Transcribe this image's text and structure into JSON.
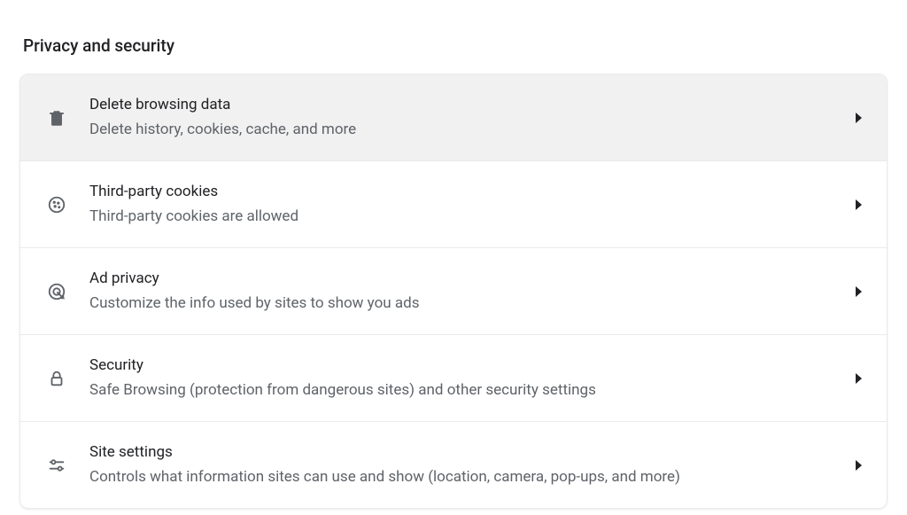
{
  "section": {
    "title": "Privacy and security"
  },
  "rows": [
    {
      "title": "Delete browsing data",
      "subtitle": "Delete history, cookies, cache, and more"
    },
    {
      "title": "Third-party cookies",
      "subtitle": "Third-party cookies are allowed"
    },
    {
      "title": "Ad privacy",
      "subtitle": "Customize the info used by sites to show you ads"
    },
    {
      "title": "Security",
      "subtitle": "Safe Browsing (protection from dangerous sites) and other security settings"
    },
    {
      "title": "Site settings",
      "subtitle": "Controls what information sites can use and show (location, camera, pop-ups, and more)"
    }
  ]
}
